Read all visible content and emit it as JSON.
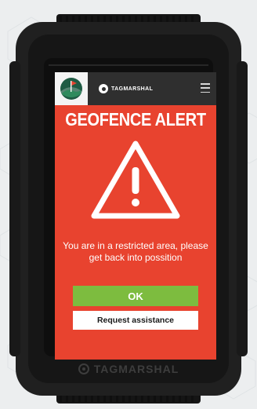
{
  "app": {
    "brand": "TAGMARSHAL",
    "logo_icon": "course-flag-logo-icon",
    "menu_icon": "hamburger-menu-icon"
  },
  "alert": {
    "title": "GEOFENCE ALERT",
    "icon": "warning-triangle-icon",
    "message": "You are in a restricted area, please get back into possition"
  },
  "actions": {
    "ok_label": "OK",
    "assist_label": "Request assistance"
  },
  "device": {
    "brand": "TAGMARSHAL"
  },
  "colors": {
    "alert_red": "#e8432f",
    "ok_green": "#7dbc3f",
    "topbar": "#2f2f2f",
    "device_body": "#1e1e1e"
  }
}
